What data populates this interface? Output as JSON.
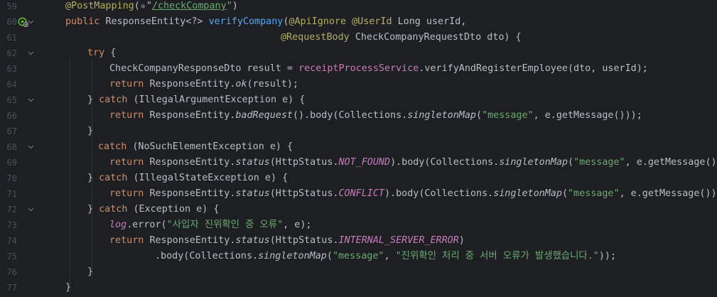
{
  "editor": {
    "lines": [
      {
        "n": "59",
        "segs": [
          [
            "ann",
            "@PostMapping"
          ],
          [
            "p",
            "("
          ],
          [
            "globe",
            ""
          ],
          [
            "p",
            "\""
          ],
          [
            "strlink",
            "/checkCompany"
          ],
          [
            "str",
            "\""
          ],
          [
            "p",
            ")"
          ]
        ]
      },
      {
        "n": "60",
        "segs": [
          [
            "kw",
            "public "
          ],
          [
            "p",
            "ResponseEntity<?> "
          ],
          [
            "fn",
            "verifyCompany"
          ],
          [
            "p",
            "("
          ],
          [
            "ann",
            "@ApiIgnore @UserId "
          ],
          [
            "p",
            "Long userId,"
          ]
        ]
      },
      {
        "n": "61",
        "segs": [
          [
            "ann",
            "@RequestBody "
          ],
          [
            "p",
            "CheckCompanyRequestDto dto) {"
          ]
        ]
      },
      {
        "n": "62",
        "segs": [
          [
            "kw",
            "try "
          ],
          [
            "p",
            "{"
          ]
        ]
      },
      {
        "n": "63",
        "segs": [
          [
            "p",
            "CheckCompanyResponseDto result = "
          ],
          [
            "fld2",
            "receiptProcessService"
          ],
          [
            "p",
            ".verifyAndRegisterEmployee(dto, userId);"
          ]
        ]
      },
      {
        "n": "64",
        "segs": [
          [
            "kw",
            "return "
          ],
          [
            "p",
            "ResponseEntity."
          ],
          [
            "st",
            "ok"
          ],
          [
            "p",
            "(result);"
          ]
        ]
      },
      {
        "n": "65",
        "segs": [
          [
            "p",
            "} "
          ],
          [
            "kw",
            "catch "
          ],
          [
            "p",
            "(IllegalArgumentException e) {"
          ]
        ]
      },
      {
        "n": "66",
        "segs": [
          [
            "kw",
            "return "
          ],
          [
            "p",
            "ResponseEntity."
          ],
          [
            "st",
            "badRequest"
          ],
          [
            "p",
            "().body(Collections."
          ],
          [
            "st",
            "singletonMap"
          ],
          [
            "p",
            "("
          ],
          [
            "str",
            "\"message\""
          ],
          [
            "p",
            ", e.getMessage()));"
          ]
        ]
      },
      {
        "n": "67",
        "segs": [
          [
            "p",
            "}"
          ]
        ]
      },
      {
        "n": "68",
        "segs": [
          [
            "kw",
            "catch "
          ],
          [
            "p",
            "(NoSuchElementException e) {"
          ]
        ]
      },
      {
        "n": "69",
        "segs": [
          [
            "kw",
            "return "
          ],
          [
            "p",
            "ResponseEntity."
          ],
          [
            "st",
            "status"
          ],
          [
            "p",
            "(HttpStatus."
          ],
          [
            "fld",
            "NOT_FOUND"
          ],
          [
            "p",
            ").body(Collections."
          ],
          [
            "st",
            "singletonMap"
          ],
          [
            "p",
            "("
          ],
          [
            "str",
            "\"message\""
          ],
          [
            "p",
            ", e.getMessage()));"
          ]
        ]
      },
      {
        "n": "70",
        "segs": [
          [
            "p",
            "} "
          ],
          [
            "kw",
            "catch "
          ],
          [
            "p",
            "(IllegalStateException e) {"
          ]
        ]
      },
      {
        "n": "71",
        "segs": [
          [
            "kw",
            "return "
          ],
          [
            "p",
            "ResponseEntity."
          ],
          [
            "st",
            "status"
          ],
          [
            "p",
            "(HttpStatus."
          ],
          [
            "fld",
            "CONFLICT"
          ],
          [
            "p",
            ").body(Collections."
          ],
          [
            "st",
            "singletonMap"
          ],
          [
            "p",
            "("
          ],
          [
            "str",
            "\"message\""
          ],
          [
            "p",
            ", e.getMessage()));"
          ]
        ]
      },
      {
        "n": "72",
        "segs": [
          [
            "p",
            "} "
          ],
          [
            "kw",
            "catch "
          ],
          [
            "p",
            "(Exception e) {"
          ]
        ]
      },
      {
        "n": "73",
        "segs": [
          [
            "log",
            "log"
          ],
          [
            "p",
            ".error("
          ],
          [
            "str",
            "\"사입자 진위확인 중 오류\""
          ],
          [
            "p",
            ", e);"
          ]
        ]
      },
      {
        "n": "74",
        "segs": [
          [
            "kw",
            "return "
          ],
          [
            "p",
            "ResponseEntity."
          ],
          [
            "st",
            "status"
          ],
          [
            "p",
            "(HttpStatus."
          ],
          [
            "fld",
            "INTERNAL_SERVER_ERROR"
          ],
          [
            "p",
            ")"
          ]
        ]
      },
      {
        "n": "75",
        "segs": [
          [
            "p",
            ".body(Collections."
          ],
          [
            "st",
            "singletonMap"
          ],
          [
            "p",
            "("
          ],
          [
            "str",
            "\"message\""
          ],
          [
            "p",
            ", "
          ],
          [
            "str",
            "\"진위확인 처리 중 서버 오류가 발생했습니다.\""
          ],
          [
            "p",
            "));"
          ]
        ]
      },
      {
        "n": "76",
        "segs": [
          [
            "p",
            "}"
          ]
        ]
      },
      {
        "n": "77",
        "segs": [
          [
            "p",
            "}"
          ]
        ]
      }
    ],
    "colors": {
      "background": "#1e1f22",
      "line_number": "#4b5059",
      "annotation": "#b3ae60",
      "keyword": "#cf8e6d",
      "method": "#56a8f5",
      "string": "#6aab73",
      "field": "#c77dbb",
      "text": "#bcbec4"
    },
    "icons": {
      "line60": "spring-endpoint-icon",
      "fold": "fold-chevron-icon"
    }
  }
}
